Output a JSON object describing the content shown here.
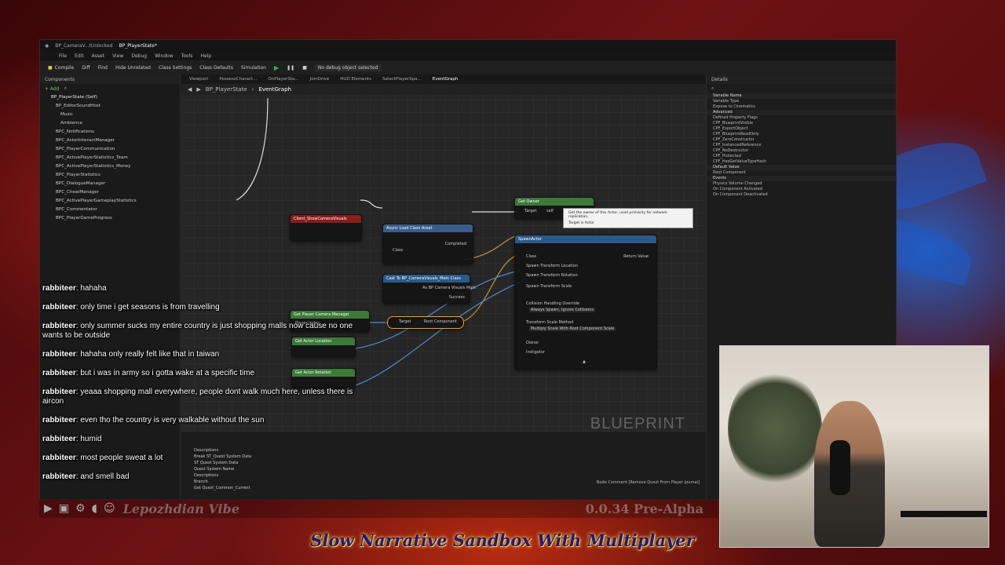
{
  "editor": {
    "tabs": [
      "BP_CameraV...tUnlocked",
      "BP_PlayerState*"
    ],
    "menu": [
      "File",
      "Edit",
      "Asset",
      "View",
      "Debug",
      "Window",
      "Tools",
      "Help"
    ],
    "toolbar": [
      "Compile",
      "Diff",
      "Find",
      "Hide Unrelated",
      "Class Settings",
      "Class Defaults",
      "Simulation"
    ],
    "debug_filter": "No debug object selected",
    "components_title": "Components",
    "add_label": "+ Add",
    "components_root": "BP_PlayerState (Self)",
    "components": [
      "BP_EditorSoundHost",
      "Music",
      "Ambience",
      "BPC_Notifications",
      "BPC_ActorInteractManager",
      "BPC_PlayerCommunication",
      "BPC_ActivePlayerStatistics_Team",
      "BPC_ActivePlayerStatistics_Money",
      "BPC_PlayerStatistics",
      "BPC_DialogueManager",
      "BPC_CheatManager",
      "BPC_ActivePlayerGameplayStatistics",
      "BPC_Commentator",
      "BPC_PlayerGameProgress"
    ],
    "graph_tabs": [
      "Viewport",
      "PossessCharact...",
      "OnPlayerSta...",
      "JoinDrive",
      "HUD Elements",
      "SelectPlayerSpa...",
      "EventGraph"
    ],
    "breadcrumb": [
      "BP_PlayerState",
      "EventGraph"
    ],
    "watermark": "BLUEPRINT",
    "details_title": "Details",
    "details_rows": [
      "Variable Name",
      "Variable Type",
      "Expose to Cinematics",
      "Advanced",
      "Defined Property Flags",
      "CPF_BlueprintVisible",
      "CPF_ExportObject",
      "CPF_BlueprintReadOnly",
      "CPF_ZeroConstructor",
      "CPF_InstancedReference",
      "CPF_NoDestructor",
      "CPF_Protected",
      "CPF_HasGetValueTypeHash",
      "Default Value",
      "Root Component",
      "Events",
      "Physics Volume Changed",
      "On Component Activated",
      "On Component Deactivated"
    ],
    "node_comment": "Node Comment [Remove Quest From Player Journal]",
    "bottom_items": [
      "Descriptions",
      "Break ST_Quest System Data",
      "ST Quest System Data",
      "Quest System Name",
      "Descriptions",
      "Branch",
      "Get Quest_Common_Current"
    ]
  },
  "nodes": {
    "custom_event": "Client_ShowCameraVisuals",
    "async_load": "Async Load Class Asset",
    "get_owner": "Get Owner",
    "spawn_actor": "SpawnActor",
    "cast_to": "Cast To BP_CameraVisuals_Main Class",
    "get_camera_manager": "Get Player Camera Manager",
    "get_actor_location": "Get Actor Location",
    "get_actor_rotation": "Get Actor Rotation",
    "root_component": "Root Component",
    "tooltip_line1": "Get the owner of this Actor, used primarily for network replication.",
    "tooltip_line2": "Target is Actor",
    "pins": [
      "Target",
      "self",
      "Completed",
      "Class",
      "Return Value",
      "Spawn Transform Location",
      "Spawn Transform Rotation",
      "Spawn Transform Scale",
      "Collision Handling Override",
      "Always Spawn, Ignore Collisions",
      "Transform Scale Method",
      "Multiply Scale With Root Component Scale",
      "Owner",
      "Instigator",
      "Player Index",
      "Success",
      "As BP Camera Visuals Main"
    ]
  },
  "chat": [
    {
      "user": "rabbiteer",
      "text": "hahaha"
    },
    {
      "user": "rabbiteer",
      "text": "only time i get seasons is from travelling"
    },
    {
      "user": "rabbiteer",
      "text": "only summer sucks my entire country is just shopping malls now cause no one wants to be outside"
    },
    {
      "user": "rabbiteer",
      "text": "hahaha only really felt like that in taiwan"
    },
    {
      "user": "rabbiteer",
      "text": "but i was in army so i gotta wake at a specific time"
    },
    {
      "user": "rabbiteer",
      "text": "yeaaa shopping mall everywhere, people dont walk much here, unless there is aircon"
    },
    {
      "user": "rabbiteer",
      "text": "even tho the country is very walkable without the sun"
    },
    {
      "user": "rabbiteer",
      "text": "humid"
    },
    {
      "user": "rabbiteer",
      "text": "most people sweat a lot"
    },
    {
      "user": "rabbiteer",
      "text": "and smell bad"
    }
  ],
  "overlay": {
    "game_name": "Lepozhdian Vibe",
    "version": "0.0.34 Pre-Alpha",
    "tagline": "Slow Narrative Sandbox With Multiplayer"
  },
  "colors": {
    "accent_blue": "#1e6edc",
    "background_red": "#6e1214"
  }
}
